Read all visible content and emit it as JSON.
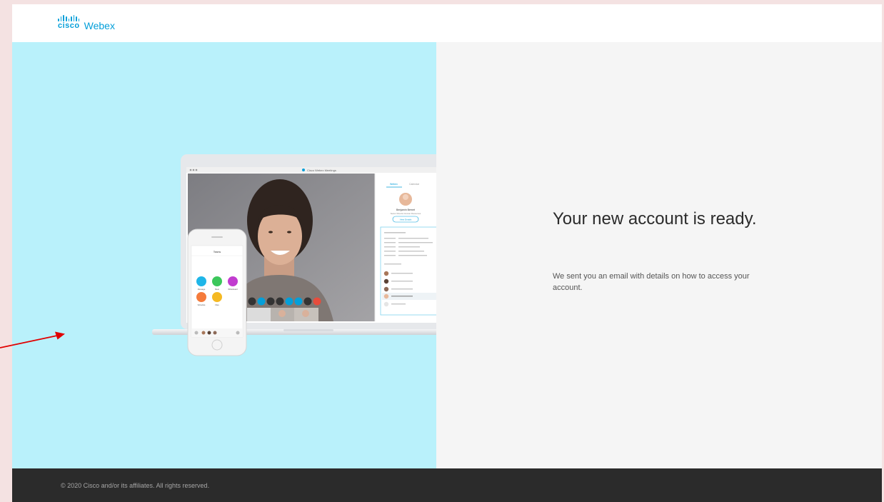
{
  "brand": {
    "cisco": "cisco",
    "product": "Webex",
    "color": "#049fd9"
  },
  "main": {
    "heading": "Your new account is ready.",
    "message": "We sent you an email with details on how to access your account."
  },
  "illustration": {
    "app_title": "Cisco Webex Meetings",
    "sidebar": {
      "tab_active": "Webex",
      "tab_inactive": "Calendar",
      "person_name": "Benjamin Bernet",
      "person_title": "Senior Director Human Resources",
      "contact_button": "View Details"
    },
    "phone": {
      "team_title": "Teams",
      "actions": [
        "Message",
        "Meet",
        "Whiteboard",
        "Schedule",
        "Files"
      ]
    }
  },
  "footer": {
    "copyright": "© 2020 Cisco and/or its affiliates. All rights reserved."
  },
  "colors": {
    "left_panel_bg": "#b9f1fb",
    "right_panel_bg": "#f5f5f5",
    "footer_bg": "#2b2b2b",
    "annotation_arrow": "#e00000"
  }
}
